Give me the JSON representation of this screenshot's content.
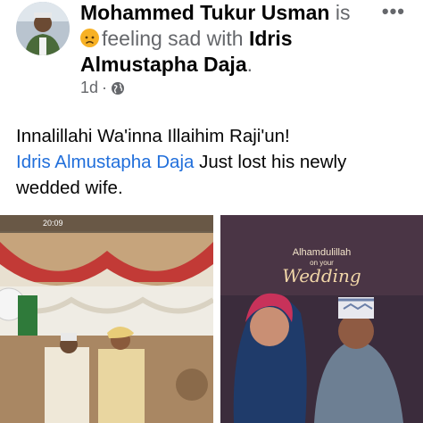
{
  "post": {
    "author": "Mohammed Tukur Usman",
    "connector": "is",
    "feeling": "feeling sad with",
    "tagged": "Idris Almustapha Daja",
    "period": ".",
    "time": "1d",
    "separator": "·",
    "privacy_icon": "globe-icon",
    "more_icon": "more-options-icon",
    "line1": "Innalillahi Wa'inna Illaihim Raji'un!",
    "mention": "Idris Almustapha Daja",
    "line2": " Just lost his newly wedded wife."
  },
  "photos": {
    "left": {
      "status_time": "20:09"
    },
    "right": {
      "banner_top": "Alhamdulillah",
      "banner_mid": "on your",
      "banner_main": "Wedding"
    }
  },
  "colors": {
    "link": "#216fdb",
    "muted": "#65676b",
    "emoji": "#f7b125"
  }
}
